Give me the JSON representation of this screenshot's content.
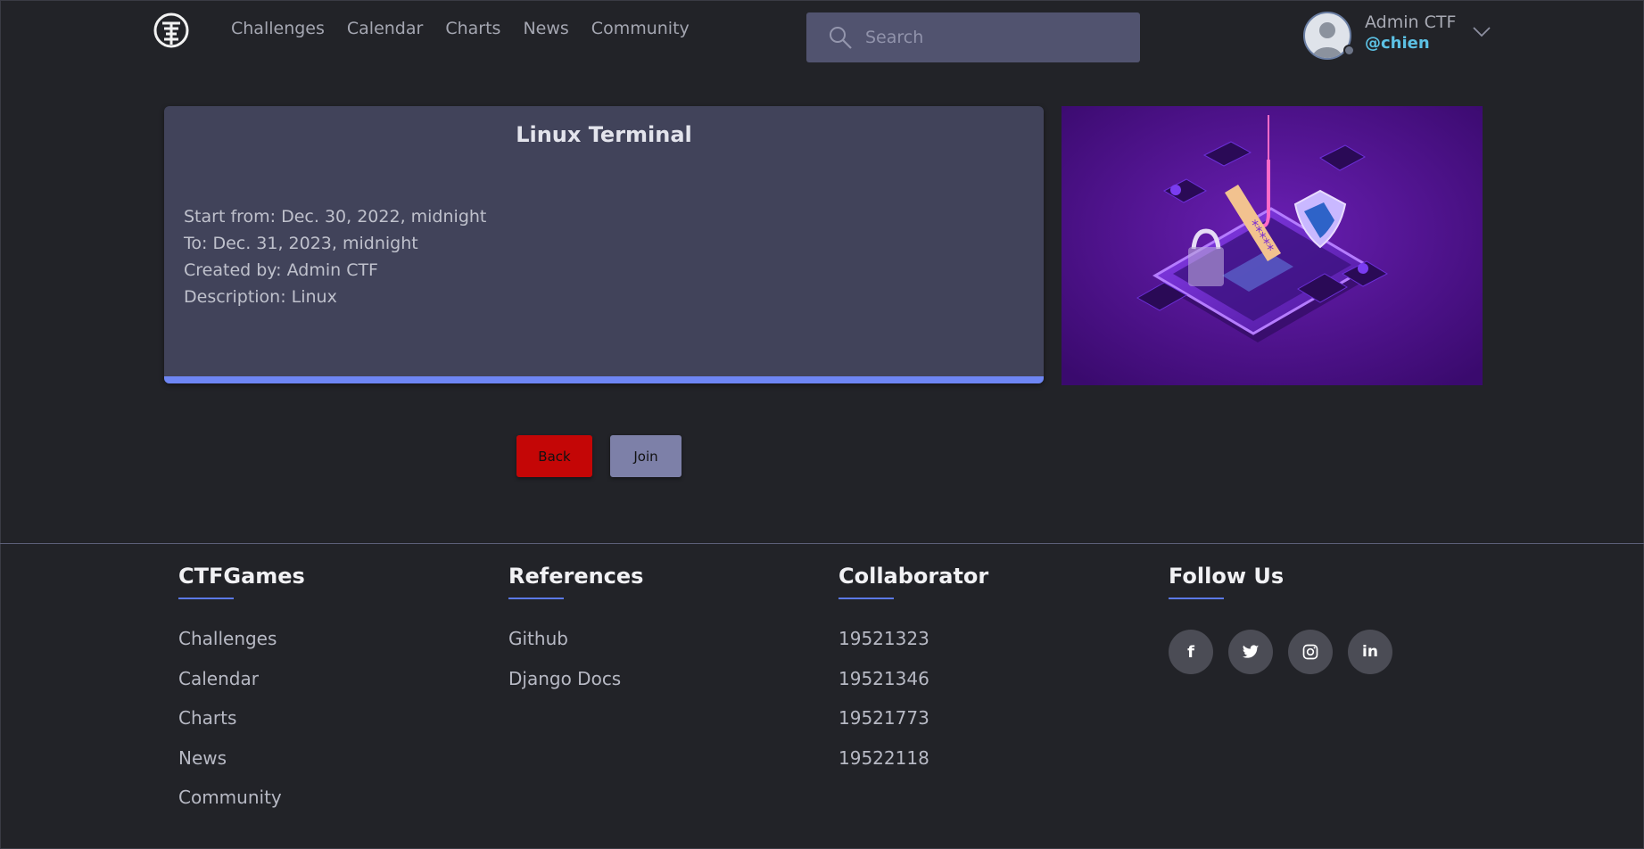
{
  "header": {
    "nav": [
      "Challenges",
      "Calendar",
      "Charts",
      "News",
      "Community"
    ],
    "search_placeholder": "Search",
    "user": {
      "name": "Admin CTF",
      "handle": "@chien"
    }
  },
  "challenge": {
    "title": "Linux Terminal",
    "start": "Start from: Dec. 30, 2022, midnight",
    "end": "To: Dec. 31, 2023, midnight",
    "creator": "Created by: Admin CTF",
    "description": "Description: Linux"
  },
  "actions": {
    "back": "Back",
    "join": "Join"
  },
  "footer": {
    "brand": {
      "title": "CTFGames",
      "links": [
        "Challenges",
        "Calendar",
        "Charts",
        "News",
        "Community"
      ]
    },
    "references": {
      "title": "References",
      "links": [
        "Github",
        "Django Docs"
      ]
    },
    "collaborator": {
      "title": "Collaborator",
      "ids": [
        "19521323",
        "19521346",
        "19521773",
        "19522118"
      ]
    },
    "follow": {
      "title": "Follow Us",
      "icons": [
        "facebook-icon",
        "twitter-icon",
        "instagram-icon",
        "linkedin-icon"
      ]
    }
  },
  "colors": {
    "accent": "#6e86f4",
    "back_button": "#c40606",
    "join_button": "#7d80a8",
    "handle": "#5cc1e4"
  }
}
